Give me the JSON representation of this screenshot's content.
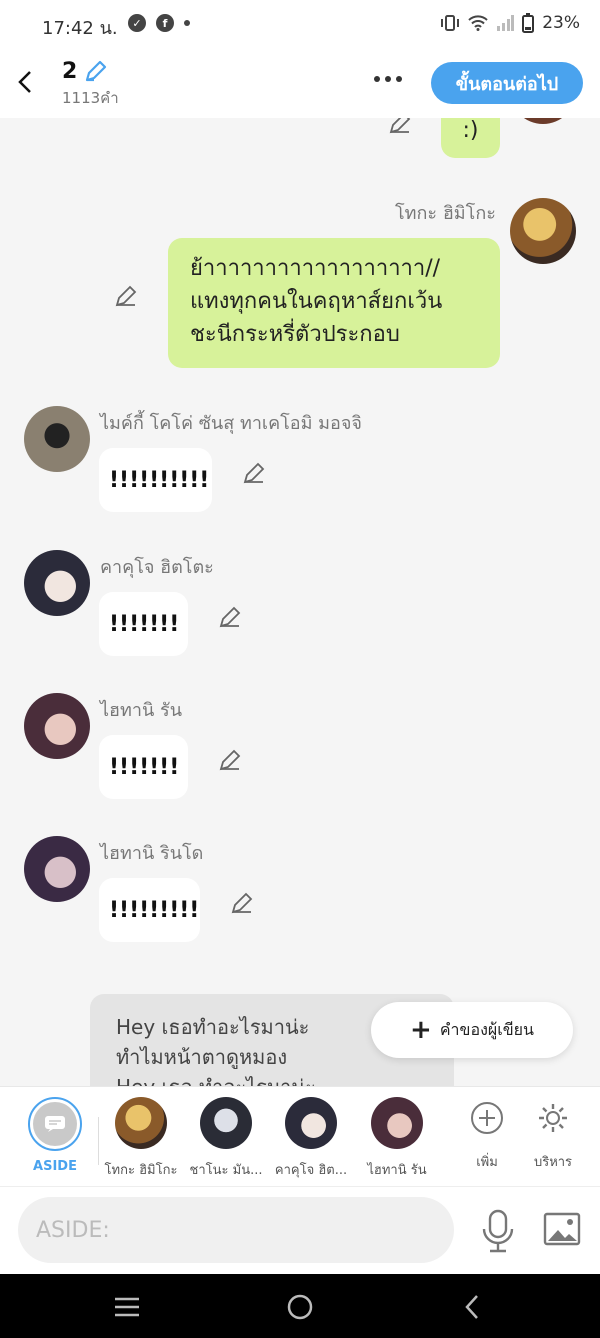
{
  "status": {
    "time": "17:42 น.",
    "battery": "23%"
  },
  "header": {
    "title": "2",
    "word_count": "1113คำ",
    "next_label": "ขั้นตอนต่อไป"
  },
  "chat": {
    "top_partial_text": ":)",
    "messages": [
      {
        "speaker": "โทกะ ฮิมิโกะ",
        "text_lines": [
          "ย้าาาาาาาาาาาาาาาาาา//",
          "แทงทุกคนในคฤหาส์ยกเว้น",
          "ชะนีกระหรี่ตัวประกอบ"
        ]
      },
      {
        "speaker": "ไมค์กี้ โคโค่ ซันสุ ทาเคโอมิ มอจจิ",
        "text": "!!!!!!!!!!"
      },
      {
        "speaker": "คาคุโจ ฮิตโตะ",
        "text": "!!!!!!!"
      },
      {
        "speaker": "ไฮทานิ รัน",
        "text": "!!!!!!!"
      },
      {
        "speaker": "ไฮทานิ รินโด",
        "text": "!!!!!!!!!"
      }
    ],
    "aside_lines": [
      "Hey เธอทำอะไรมาน่ะ",
      "ทำไมหน้าตาดูหมอง",
      "Hey เธอ ทำอะไรมาน่ะ"
    ],
    "author_button": "คำของผู้เขียน"
  },
  "characters": [
    {
      "label": "ASIDE"
    },
    {
      "label": "โทกะ ฮิมิโกะ"
    },
    {
      "label": "ชาโนะ มัน..."
    },
    {
      "label": "คาคุโจ ฮิต..."
    },
    {
      "label": "ไฮทานิ รัน"
    },
    {
      "label": "เพิ่ม"
    },
    {
      "label": "บริหาร"
    }
  ],
  "input": {
    "placeholder": "ASIDE:"
  },
  "colors": {
    "accent": "#4aa3ee",
    "bubble_green": "#d7f29a",
    "bubble_white": "#ffffff"
  }
}
